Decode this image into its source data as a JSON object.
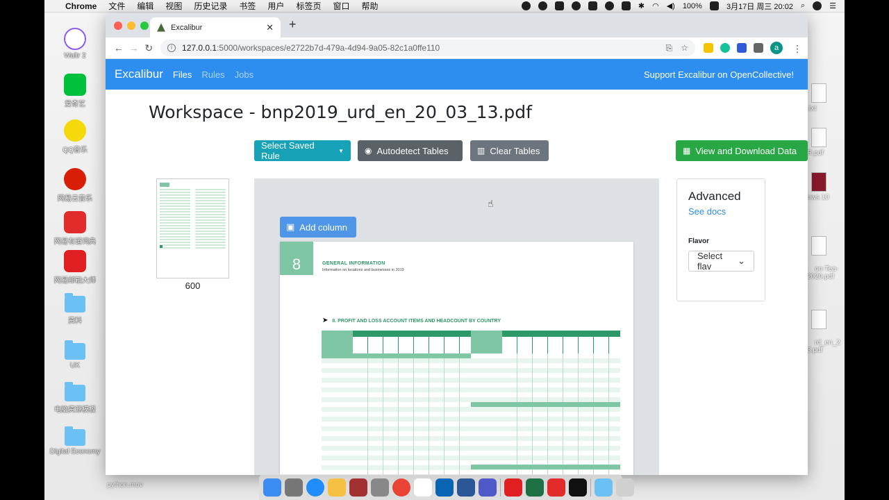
{
  "menubar": {
    "app": "Chrome",
    "items": [
      "文件",
      "编辑",
      "视图",
      "历史记录",
      "书签",
      "用户",
      "标签页",
      "窗口",
      "帮助"
    ],
    "battery": "100%",
    "datetime": "3月17日 周三  20:02"
  },
  "desktop": {
    "left_icons": [
      {
        "name": "waltr-icon",
        "label": "Waltr 2",
        "color": "#ffffff"
      },
      {
        "name": "iqiyi-icon",
        "label": "爱奇艺",
        "color": "#00c03c"
      },
      {
        "name": "qq-music-icon",
        "label": "QQ音乐",
        "color": "#31c27c"
      },
      {
        "name": "netease-music-icon",
        "label": "网易云音乐",
        "color": "#d81e06"
      },
      {
        "name": "youdao-icon",
        "label": "网易有道词典",
        "color": "#e22b2b"
      },
      {
        "name": "netease-mail-icon",
        "label": "网易邮箱大师",
        "color": "#e02020"
      }
    ],
    "folders": [
      "资料",
      "UK",
      "电脑资源模板",
      "Digital Economy"
    ],
    "right_files": [
      ".txt",
      "R.pdf",
      "ows 10",
      "on-Tea-\n2020.pdf",
      "rd_en_2\n3.pdf"
    ],
    "bottom_file": "python.mov"
  },
  "browser": {
    "tab_title": "Excalibur",
    "url_host": "127.0.0.1",
    "url_path": ":5000/workspaces/e2722b7d-479a-4d94-9a05-82c1a0ffe110",
    "avatar_letter": "a"
  },
  "app": {
    "brand": "Excalibur",
    "nav": [
      {
        "label": "Files",
        "active": true
      },
      {
        "label": "Rules",
        "active": false
      },
      {
        "label": "Jobs",
        "active": false
      }
    ],
    "support_link": "Support Excalibur on OpenCollective!",
    "workspace_title": "Workspace - bnp2019_urd_en_20_03_13.pdf",
    "buttons": {
      "select_rule": "Select Saved Rule",
      "autodetect": "Autodetect Tables",
      "clear": "Clear Tables",
      "view_download": "View and Download Data",
      "add_column": "Add column"
    },
    "page_number": "600",
    "advanced": {
      "title": "Advanced",
      "docs_link": "See docs",
      "flavor_label": "Flavor",
      "flavor_value": "Select flav"
    },
    "pdf": {
      "section_number": "8",
      "section_title": "GENERAL INFORMATION",
      "section_subtitle": "Information on locations and businesses in 2019",
      "table_heading": "II. PROFIT AND LOSS ACCOUNT ITEMS AND HEADCOUNT BY COUNTRY"
    }
  },
  "colors": {
    "navbar": "#2e8ef0",
    "teal": "#17a2b8",
    "green": "#28a745",
    "pdf_green": "#2e9968"
  }
}
